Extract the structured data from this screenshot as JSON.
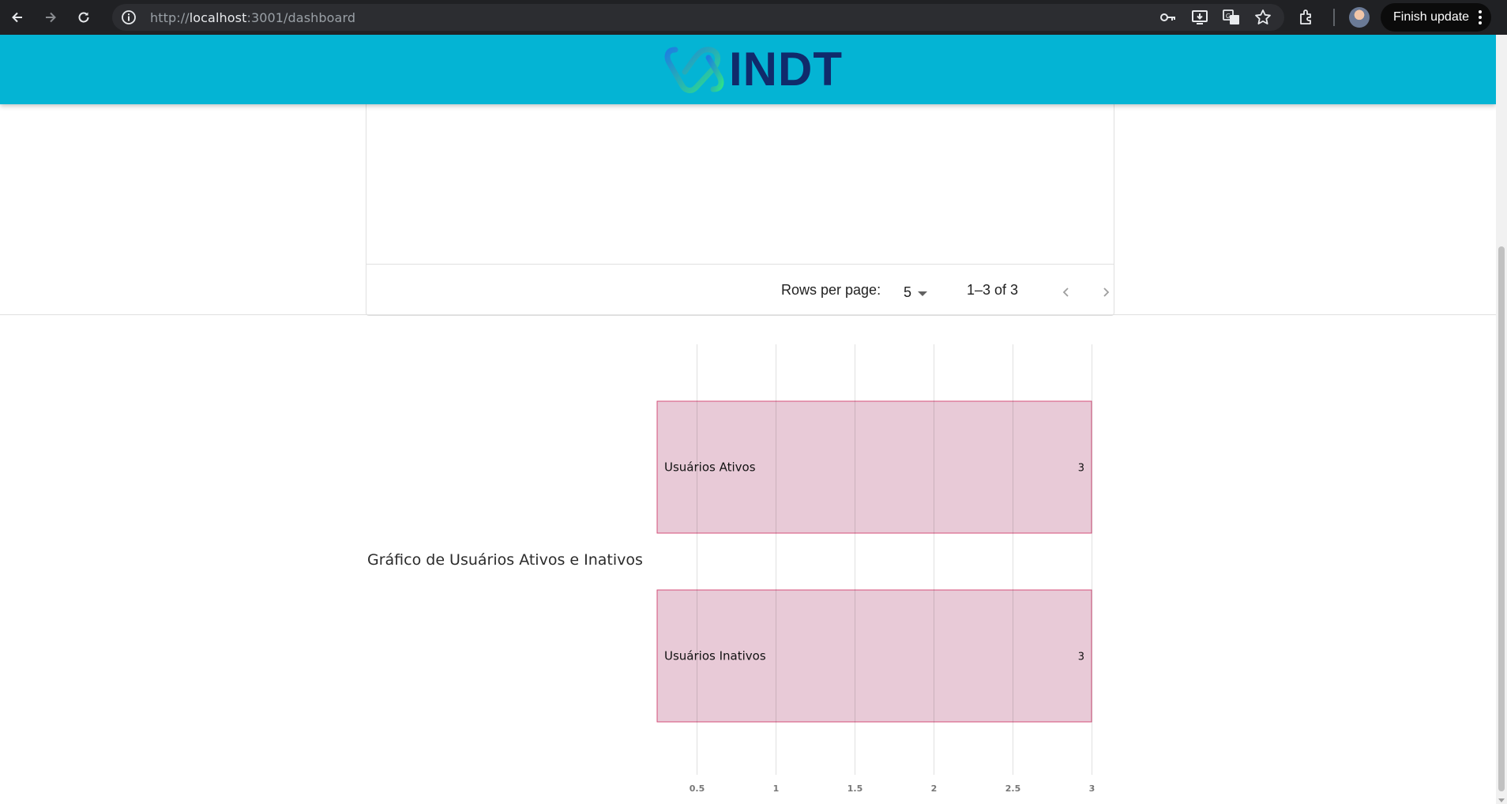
{
  "browser": {
    "url_scheme": "http://",
    "url_host": "localhost",
    "url_rest": ":3001/dashboard",
    "finish_update_label": "Finish update",
    "icons": [
      "back-icon",
      "forward-icon",
      "reload-icon",
      "site-info-icon",
      "password-key-icon",
      "install-app-icon",
      "translate-icon",
      "bookmark-star-icon",
      "extensions-icon",
      "profile-avatar",
      "menu-kebab-icon"
    ]
  },
  "header": {
    "logo_text": "INDT",
    "brand_color": "#04b4d4"
  },
  "table_pagination": {
    "rows_per_page_label": "Rows per page:",
    "rows_per_page_value": "5",
    "range_label": "1–3 of 3"
  },
  "chart_section": {
    "title": "Gráfico de Usuários Ativos e Inativos"
  },
  "chart_data": {
    "type": "bar",
    "orientation": "horizontal",
    "title": "Gráfico de Usuários Ativos e Inativos",
    "categories": [
      "Usuários Ativos",
      "Usuários Inativos"
    ],
    "values": [
      3,
      3
    ],
    "value_labels": [
      "3",
      "3"
    ],
    "xlim": [
      0.25,
      3
    ],
    "ticks": [
      0.5,
      1,
      1.5,
      2,
      2.5,
      3
    ],
    "tick_labels": [
      "0.5",
      "1",
      "1.5",
      "2",
      "2.5",
      "3"
    ],
    "grid": true,
    "bar_fill": "#e8cad7",
    "bar_stroke": "#d44f7a"
  }
}
